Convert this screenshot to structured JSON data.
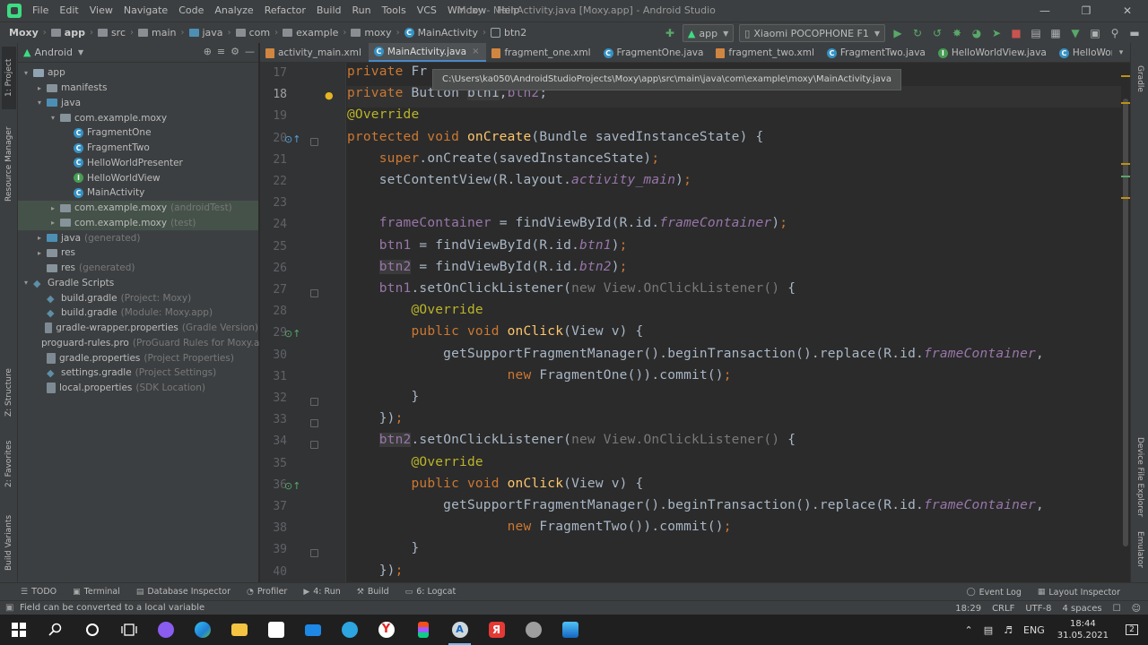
{
  "window": {
    "title": "Moxy - MainActivity.java [Moxy.app] - Android Studio",
    "menu": [
      "File",
      "Edit",
      "View",
      "Navigate",
      "Code",
      "Analyze",
      "Refactor",
      "Build",
      "Run",
      "Tools",
      "VCS",
      "Window",
      "Help"
    ]
  },
  "breadcrumb": {
    "items": [
      "Moxy",
      "app",
      "src",
      "main",
      "java",
      "com",
      "example",
      "moxy",
      "MainActivity",
      "btn2"
    ]
  },
  "toolbar": {
    "run_config": "app",
    "device": "Xiaomi POCOPHONE F1"
  },
  "project_panel": {
    "view_mode": "Android",
    "tree": [
      {
        "label": "app",
        "hint": "",
        "kind": "module"
      },
      {
        "label": "manifests",
        "hint": "",
        "kind": "folder"
      },
      {
        "label": "java",
        "hint": "",
        "kind": "folder"
      },
      {
        "label": "com.example.moxy",
        "hint": "",
        "kind": "package"
      },
      {
        "label": "FragmentOne",
        "hint": "",
        "kind": "class"
      },
      {
        "label": "FragmentTwo",
        "hint": "",
        "kind": "class"
      },
      {
        "label": "HelloWorldPresenter",
        "hint": "",
        "kind": "class"
      },
      {
        "label": "HelloWorldView",
        "hint": "",
        "kind": "interface"
      },
      {
        "label": "MainActivity",
        "hint": "",
        "kind": "class"
      },
      {
        "label": "com.example.moxy",
        "hint": "(androidTest)",
        "kind": "package"
      },
      {
        "label": "com.example.moxy",
        "hint": "(test)",
        "kind": "package"
      },
      {
        "label": "java",
        "hint": "(generated)",
        "kind": "folder"
      },
      {
        "label": "res",
        "hint": "",
        "kind": "folder"
      },
      {
        "label": "res",
        "hint": "(generated)",
        "kind": "folder"
      },
      {
        "label": "Gradle Scripts",
        "hint": "",
        "kind": "gradle-root"
      },
      {
        "label": "build.gradle",
        "hint": "(Project: Moxy)",
        "kind": "gradle"
      },
      {
        "label": "build.gradle",
        "hint": "(Module: Moxy.app)",
        "kind": "gradle"
      },
      {
        "label": "gradle-wrapper.properties",
        "hint": "(Gradle Version)",
        "kind": "props"
      },
      {
        "label": "proguard-rules.pro",
        "hint": "(ProGuard Rules for Moxy.app)",
        "kind": "props"
      },
      {
        "label": "gradle.properties",
        "hint": "(Project Properties)",
        "kind": "props"
      },
      {
        "label": "settings.gradle",
        "hint": "(Project Settings)",
        "kind": "gradle"
      },
      {
        "label": "local.properties",
        "hint": "(SDK Location)",
        "kind": "props"
      }
    ]
  },
  "tool_strips": {
    "left": [
      "1: Project",
      "Resource Manager",
      "Z: Structure",
      "2: Favorites",
      "Build Variants"
    ],
    "right": [
      "Gradle",
      "Device File Explorer",
      "Emulator"
    ]
  },
  "editor_tabs": [
    {
      "label": "activity_main.xml",
      "type": "xml"
    },
    {
      "label": "MainActivity.java",
      "type": "class",
      "active": true
    },
    {
      "label": "fragment_one.xml",
      "type": "xml"
    },
    {
      "label": "FragmentOne.java",
      "type": "class"
    },
    {
      "label": "fragment_two.xml",
      "type": "xml"
    },
    {
      "label": "FragmentTwo.java",
      "type": "class"
    },
    {
      "label": "HelloWorldView.java",
      "type": "interface"
    },
    {
      "label": "HelloWorldPres",
      "type": "class"
    }
  ],
  "tooltip": "C:\\Users\\ka050\\AndroidStudioProjects\\Moxy\\app\\src\\main\\java\\com\\example\\moxy\\MainActivity.java",
  "editor": {
    "line_numbers": [
      "17",
      "18",
      "19",
      "20",
      "21",
      "22",
      "23",
      "24",
      "25",
      "26",
      "27",
      "28",
      "29",
      "30",
      "31",
      "32",
      "33",
      "34",
      "35",
      "36",
      "37",
      "38",
      "39",
      "40"
    ],
    "current_line": "18"
  },
  "bottom_tools": {
    "left": [
      {
        "label": "TODO",
        "icon": "list-icon"
      },
      {
        "label": "Terminal",
        "icon": "terminal-icon"
      },
      {
        "label": "Database Inspector",
        "icon": "database-icon"
      },
      {
        "label": "Profiler",
        "icon": "gauge-icon"
      },
      {
        "label": "4: Run",
        "icon": "run-icon"
      },
      {
        "label": "Build",
        "icon": "hammer-icon"
      },
      {
        "label": "6: Logcat",
        "icon": "logcat-icon"
      }
    ],
    "right": [
      {
        "label": "Event Log",
        "icon": "event-log-icon"
      },
      {
        "label": "Layout Inspector",
        "icon": "layout-inspector-icon"
      }
    ]
  },
  "status": {
    "message": "Field can be converted to a local variable",
    "position": "18:29",
    "line_ending": "CRLF",
    "encoding": "UTF-8",
    "indent": "4 spaces"
  },
  "taskbar": {
    "language": "ENG",
    "time": "18:44",
    "date": "31.05.2021",
    "notifications": "2"
  }
}
